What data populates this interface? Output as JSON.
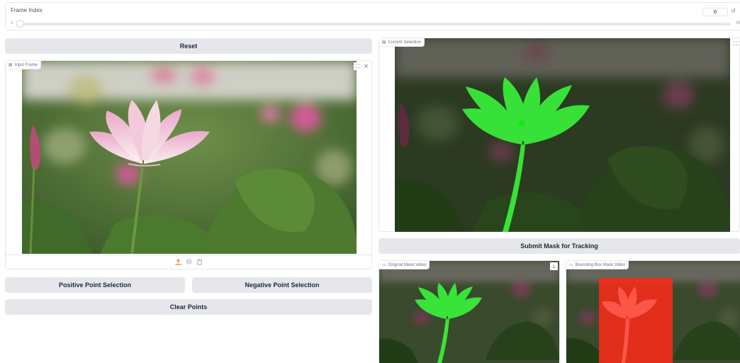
{
  "frame_index": {
    "label": "Frame Index",
    "value": "0",
    "reset_glyph": "↺",
    "min": "0",
    "max": "48",
    "progress": 0
  },
  "buttons": {
    "reset": "Reset",
    "positive": "Positive Point Selection",
    "negative": "Negative Point Selection",
    "clear": "Clear Points",
    "submit": "Submit Mask for Tracking"
  },
  "input_frame": {
    "label": "Input Frame",
    "fullscreen": "⛶",
    "close": "✕"
  },
  "current_selection": {
    "label": "Current Selection",
    "fullscreen": "⛶"
  },
  "original_mask_video": {
    "label": "Original Mask Video",
    "download": "⤓"
  },
  "bbox_mask_video": {
    "label": "Bounding Box Mask Video"
  },
  "colors": {
    "mask_green": "#39ff3c",
    "mask_red": "#ff2a1a",
    "accent": "#f97316"
  }
}
